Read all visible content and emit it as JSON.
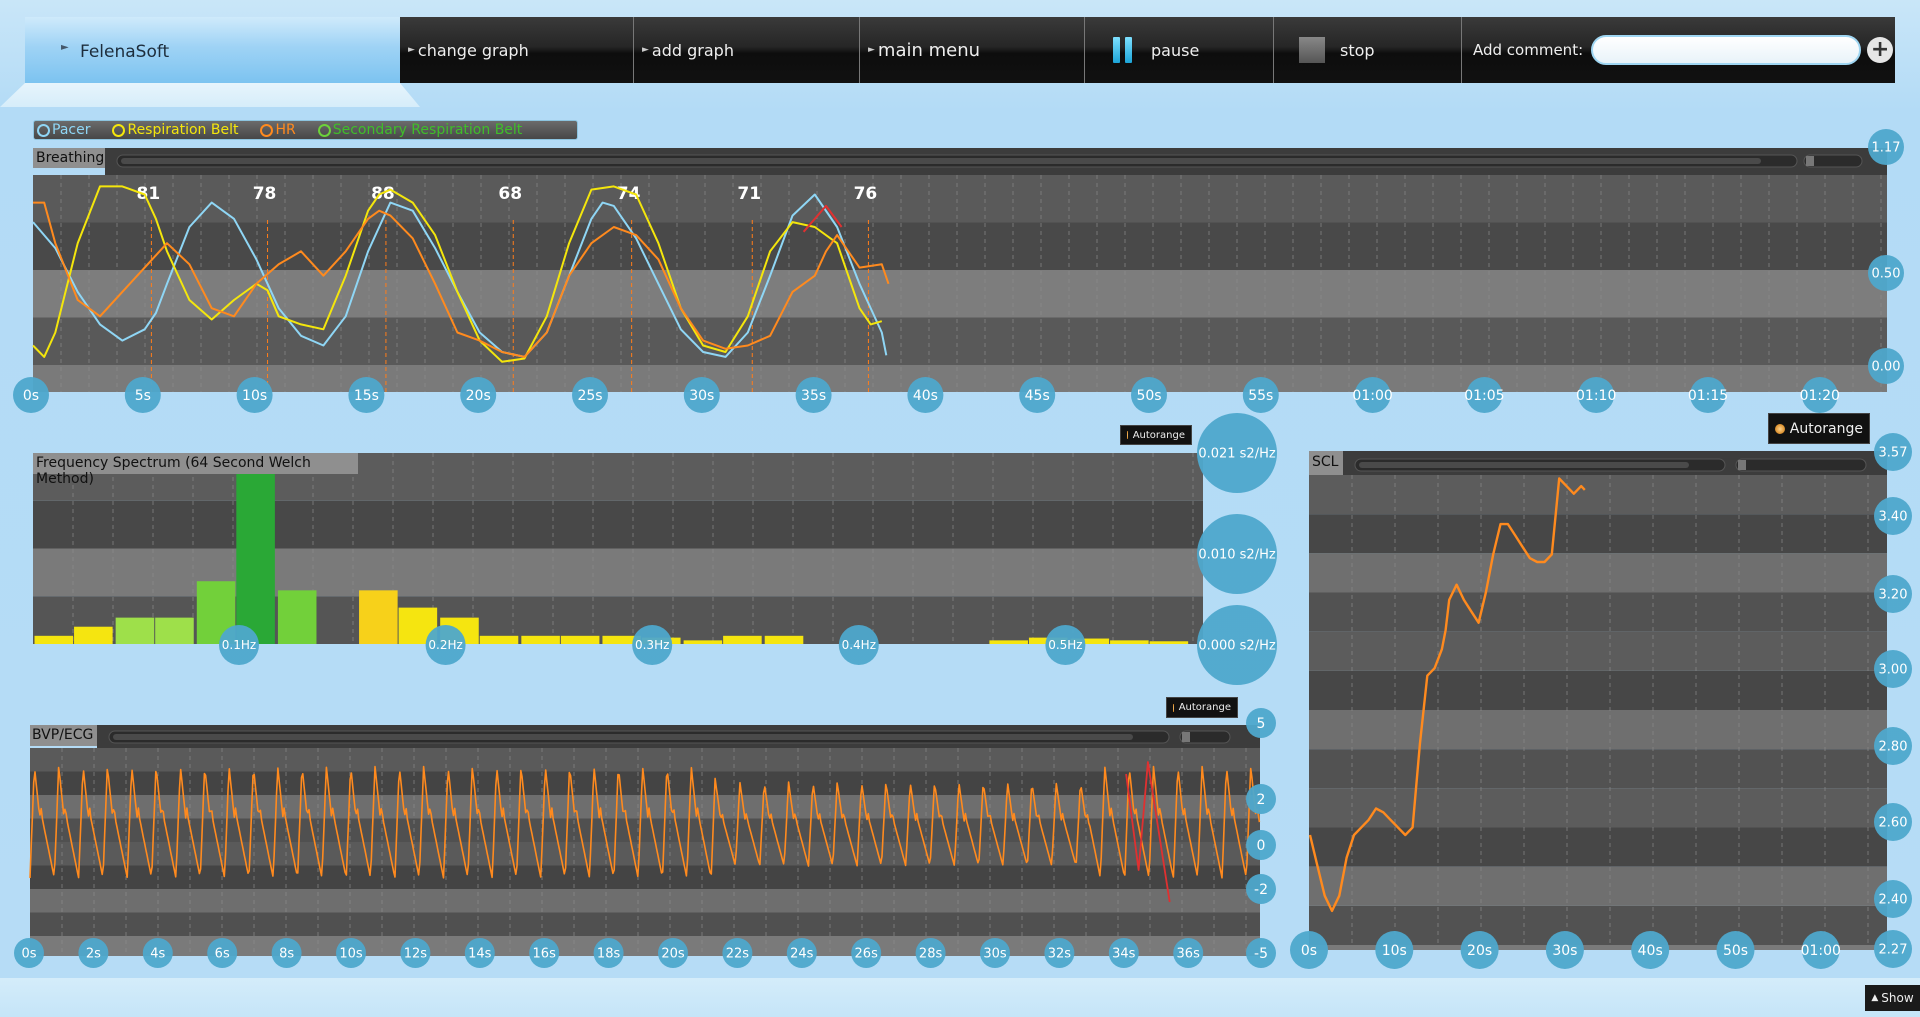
{
  "app": {
    "brand": "FelenaSoft"
  },
  "toolbar": {
    "change_graph": "change graph",
    "add_graph": "add graph",
    "main_menu": "main menu",
    "pause": "pause",
    "stop": "stop",
    "add_comment_label": "Add comment:",
    "comment_value": "",
    "comment_placeholder": ""
  },
  "colors": {
    "pacer": "#8fd6f5",
    "respiration": "#f4e60c",
    "hr": "#ff8a1e",
    "secondary": "#6cd23a",
    "accent_circle": "#4ea8cc"
  },
  "breathing": {
    "title": "Breathing",
    "legend": [
      {
        "label": "Pacer",
        "color": "#8fd6f5"
      },
      {
        "label": "Respiration Belt",
        "color": "#f4e60c"
      },
      {
        "label": "HR",
        "color": "#ff8a1e"
      },
      {
        "label": "Secondary Respiration Belt",
        "color": "#6cd23a"
      }
    ],
    "chart_data": {
      "type": "line",
      "x_ticks": [
        "0s",
        "5s",
        "10s",
        "15s",
        "20s",
        "25s",
        "30s",
        "35s",
        "40s",
        "45s",
        "50s",
        "55s",
        "01:00",
        "01:05",
        "01:10",
        "01:15",
        "01:20"
      ],
      "y_ticks": [
        "1.17",
        "0.50",
        "0.00"
      ],
      "ylim": [
        0,
        1.17
      ],
      "xlim": [
        0,
        83
      ],
      "annotations": [
        {
          "x": 5.3,
          "label": "81"
        },
        {
          "x": 10.5,
          "label": "78"
        },
        {
          "x": 15.8,
          "label": "88"
        },
        {
          "x": 21.5,
          "label": "68"
        },
        {
          "x": 26.8,
          "label": "74"
        },
        {
          "x": 32.2,
          "label": "71"
        },
        {
          "x": 37.4,
          "label": "76"
        }
      ],
      "series": [
        {
          "name": "Pacer",
          "color": "#8fd6f5",
          "x": [
            0,
            1,
            2,
            3,
            4,
            5,
            5.5,
            6,
            7,
            8,
            9,
            10,
            11,
            12,
            13,
            14,
            15,
            15.5,
            16,
            17,
            18,
            19,
            20,
            21,
            22,
            23,
            24,
            25,
            25.5,
            26,
            27,
            28,
            29,
            30,
            31,
            32,
            33,
            34,
            35,
            36,
            37,
            38,
            38.2
          ],
          "y": [
            0.88,
            0.72,
            0.45,
            0.25,
            0.15,
            0.22,
            0.32,
            0.5,
            0.85,
            1.0,
            0.9,
            0.65,
            0.35,
            0.18,
            0.12,
            0.3,
            0.7,
            0.85,
            1.0,
            0.95,
            0.72,
            0.45,
            0.2,
            0.08,
            0.05,
            0.2,
            0.55,
            0.9,
            1.0,
            0.98,
            0.78,
            0.5,
            0.22,
            0.08,
            0.05,
            0.2,
            0.55,
            0.92,
            1.05,
            0.85,
            0.5,
            0.2,
            0.06
          ]
        },
        {
          "name": "Respiration Belt",
          "color": "#f4e60c",
          "x": [
            0,
            0.5,
            1,
            2,
            3,
            4,
            5,
            5.5,
            6,
            7,
            8,
            9,
            10,
            10.5,
            11,
            12,
            13,
            14,
            15,
            15.5,
            16,
            17,
            18,
            19,
            20,
            21,
            22,
            23,
            24,
            25,
            26,
            27,
            28,
            29,
            30,
            31,
            32,
            33,
            34,
            35,
            36,
            37,
            37.5,
            38
          ],
          "y": [
            0.12,
            0.05,
            0.2,
            0.75,
            1.1,
            1.1,
            1.05,
            0.9,
            0.7,
            0.4,
            0.28,
            0.4,
            0.5,
            0.46,
            0.3,
            0.25,
            0.22,
            0.55,
            0.95,
            1.05,
            1.08,
            1.0,
            0.8,
            0.45,
            0.15,
            0.02,
            0.04,
            0.3,
            0.75,
            1.08,
            1.1,
            1.05,
            0.75,
            0.35,
            0.12,
            0.08,
            0.3,
            0.7,
            0.88,
            0.85,
            0.75,
            0.35,
            0.25,
            0.27
          ]
        },
        {
          "name": "HR",
          "color": "#ff8a1e",
          "x": [
            0,
            0.5,
            1,
            2,
            3,
            4,
            5,
            6,
            7,
            8,
            9,
            10,
            11,
            12,
            13,
            14,
            15,
            15.5,
            16,
            17,
            18,
            19,
            20,
            21,
            22,
            23,
            24,
            25,
            26,
            27,
            28,
            29,
            30,
            31,
            32,
            33,
            34,
            35,
            35.5,
            36,
            37,
            38,
            38.3
          ],
          "y": [
            1.0,
            1.0,
            0.75,
            0.4,
            0.3,
            0.45,
            0.6,
            0.75,
            0.62,
            0.35,
            0.3,
            0.5,
            0.62,
            0.7,
            0.55,
            0.7,
            0.9,
            0.95,
            0.92,
            0.78,
            0.5,
            0.2,
            0.15,
            0.08,
            0.05,
            0.2,
            0.55,
            0.75,
            0.85,
            0.8,
            0.65,
            0.35,
            0.15,
            0.1,
            0.12,
            0.18,
            0.45,
            0.55,
            0.7,
            0.8,
            0.6,
            0.62,
            0.5
          ]
        },
        {
          "name": "Secondary Respiration Belt",
          "color": "#6cd23a",
          "x": [],
          "y": []
        }
      ]
    }
  },
  "spectrum": {
    "title": "Frequency Spectrum (64 Second Welch Method)",
    "autorange": "Autorange",
    "chart_data": {
      "type": "bar",
      "x_ticks": [
        "0.1Hz",
        "0.2Hz",
        "0.3Hz",
        "0.4Hz",
        "0.5Hz"
      ],
      "y_ticks": [
        "0.021 s2/Hz",
        "0.010 s2/Hz",
        "0.000 s2/Hz"
      ],
      "ylim": [
        0,
        0.021
      ],
      "xlim": [
        0,
        0.56
      ],
      "bin_width": 0.0195,
      "bins": [
        {
          "f": 0.01,
          "v": 0.0009,
          "c": "#f5e510"
        },
        {
          "f": 0.029,
          "v": 0.0019,
          "c": "#f5e510"
        },
        {
          "f": 0.049,
          "v": 0.0029,
          "c": "#9ee04a"
        },
        {
          "f": 0.068,
          "v": 0.0029,
          "c": "#9ee04a"
        },
        {
          "f": 0.088,
          "v": 0.0069,
          "c": "#72d03a"
        },
        {
          "f": 0.107,
          "v": 0.0205,
          "c": "#2aa836"
        },
        {
          "f": 0.127,
          "v": 0.0059,
          "c": "#72d03a"
        },
        {
          "f": 0.166,
          "v": 0.0059,
          "c": "#f7d11a"
        },
        {
          "f": 0.185,
          "v": 0.004,
          "c": "#f5e510"
        },
        {
          "f": 0.205,
          "v": 0.0029,
          "c": "#f5e510"
        },
        {
          "f": 0.224,
          "v": 0.0009,
          "c": "#f5e510"
        },
        {
          "f": 0.244,
          "v": 0.0009,
          "c": "#f5e510"
        },
        {
          "f": 0.263,
          "v": 0.0009,
          "c": "#f5e510"
        },
        {
          "f": 0.283,
          "v": 0.0009,
          "c": "#f5e510"
        },
        {
          "f": 0.302,
          "v": 0.0007,
          "c": "#f5e510"
        },
        {
          "f": 0.322,
          "v": 0.0004,
          "c": "#f5e510"
        },
        {
          "f": 0.341,
          "v": 0.0009,
          "c": "#f5e510"
        },
        {
          "f": 0.361,
          "v": 0.0009,
          "c": "#f5e510"
        },
        {
          "f": 0.469,
          "v": 0.0004,
          "c": "#f5e510"
        },
        {
          "f": 0.488,
          "v": 0.0007,
          "c": "#f5e510"
        },
        {
          "f": 0.508,
          "v": 0.0006,
          "c": "#f5e510"
        },
        {
          "f": 0.527,
          "v": 0.0004,
          "c": "#f5e510"
        },
        {
          "f": 0.546,
          "v": 0.0003,
          "c": "#f5e510"
        }
      ]
    }
  },
  "bvp": {
    "title": "BVP/ECG",
    "autorange": "Autorange",
    "chart_data": {
      "type": "line",
      "x_ticks": [
        "0s",
        "2s",
        "4s",
        "6s",
        "8s",
        "10s",
        "12s",
        "14s",
        "16s",
        "18s",
        "20s",
        "22s",
        "24s",
        "26s",
        "28s",
        "30s",
        "32s",
        "34s",
        "36s"
      ],
      "y_ticks": [
        "5",
        "2",
        "0",
        "-2",
        "-5"
      ],
      "ylim": [
        -5,
        5
      ],
      "xlim": [
        0,
        39.5
      ],
      "beats_per_second": 1.28,
      "amplitude_top": 3.2,
      "amplitude_bottom": -2.4,
      "artifact_x": [
        35.2,
        36.6
      ],
      "series": [
        {
          "name": "BVP",
          "color": "#ff8a1e"
        },
        {
          "name": "artifact",
          "color": "#e03030"
        }
      ]
    }
  },
  "scl": {
    "title": "SCL",
    "autorange": "Autorange",
    "chart_data": {
      "type": "line",
      "x_ticks": [
        "0s",
        "10s",
        "20s",
        "30s",
        "40s",
        "50s",
        "01:00"
      ],
      "y_ticks": [
        "3.57",
        "3.40",
        "3.20",
        "3.00",
        "2.80",
        "2.60",
        "2.40",
        "2.27"
      ],
      "ylim": [
        2.27,
        3.57
      ],
      "xlim": [
        0,
        70
      ],
      "series": [
        {
          "name": "SCL",
          "color": "#ff8a1e",
          "x": [
            0,
            1,
            2,
            3,
            4,
            5,
            6,
            7,
            8,
            9,
            10,
            11,
            12,
            13,
            14,
            15,
            16,
            17,
            18,
            18.5,
            19,
            20,
            21,
            22,
            23,
            24,
            25,
            26,
            27,
            28,
            29,
            30,
            31,
            32,
            33,
            34,
            35,
            36,
            37,
            37.5
          ],
          "y": [
            2.56,
            2.48,
            2.4,
            2.36,
            2.4,
            2.5,
            2.56,
            2.58,
            2.6,
            2.63,
            2.62,
            2.6,
            2.58,
            2.56,
            2.58,
            2.8,
            2.98,
            3.0,
            3.05,
            3.1,
            3.18,
            3.22,
            3.18,
            3.15,
            3.12,
            3.2,
            3.3,
            3.38,
            3.38,
            3.35,
            3.32,
            3.29,
            3.28,
            3.28,
            3.3,
            3.5,
            3.48,
            3.46,
            3.48,
            3.47
          ]
        }
      ]
    }
  },
  "footer": {
    "show": "Show"
  }
}
